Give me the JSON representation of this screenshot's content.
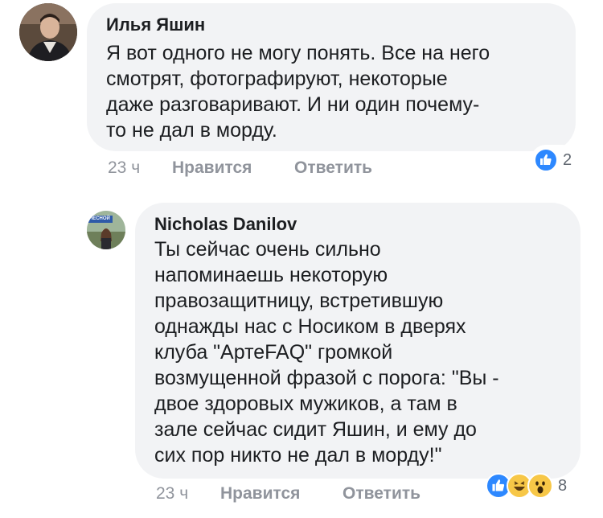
{
  "comments": [
    {
      "author": "Илья Яшин",
      "text": "Я вот одного не могу понять. Все на него\nсмотрят, фотографируют, некоторые\nдаже разговаривают. И ни один почему-\nто не дал в морду.",
      "time": "23 ч",
      "like_label": "Нравится",
      "reply_label": "Ответить",
      "reaction_count": "2",
      "reaction_icons": [
        "like-icon"
      ]
    },
    {
      "author": "Nicholas Danilov",
      "avatar_sign": "ЛЕСНОЙ",
      "text": "Ты сейчас очень сильно\nнапоминаешь некоторую\nправозащитницу, встретившую\nоднажды нас с Носиком в дверях\nклуба \"АртеFAQ\" громкой\nвозмущенной фразой с порога: \"Вы -\nдвое здоровых мужиков, а там в\nзале сейчас сидит Яшин, и ему до\nсих пор никто не дал в морду!\"",
      "time": "23 ч",
      "like_label": "Нравится",
      "reply_label": "Ответить",
      "reaction_count": "8",
      "reaction_icons": [
        "like-icon",
        "haha-icon",
        "wow-icon"
      ]
    }
  ],
  "colors": {
    "bubble": "#f2f3f5",
    "meta": "#90949c",
    "like_blue": "#2d88ff",
    "emoji_yellow": "#f7c747"
  }
}
